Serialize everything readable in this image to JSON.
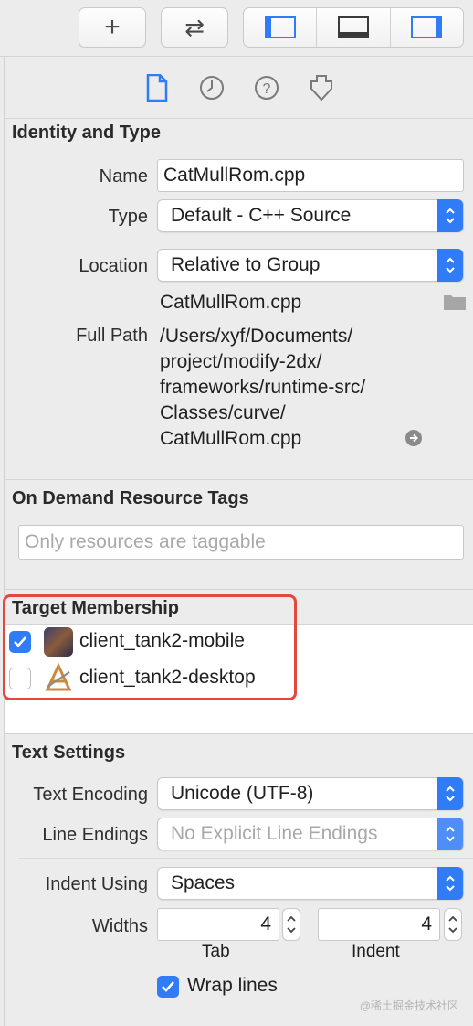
{
  "toolbar": {
    "add_glyph": "+",
    "swap_glyph": "⇄"
  },
  "tabs": [
    "file-inspector-icon",
    "history-icon",
    "help-icon",
    "attributes-icon"
  ],
  "identity": {
    "title": "Identity and Type",
    "name_label": "Name",
    "name_value": "CatMullRom.cpp",
    "type_label": "Type",
    "type_value": "Default - C++ Source",
    "location_label": "Location",
    "location_value": "Relative to Group",
    "file_name": "CatMullRom.cpp",
    "full_path_label": "Full Path",
    "full_path_lines": [
      "/Users/xyf/Documents/",
      "project/modify-2dx/",
      "frameworks/runtime-src/",
      "Classes/curve/",
      "CatMullRom.cpp"
    ]
  },
  "odr": {
    "title": "On Demand Resource Tags",
    "placeholder": "Only resources are taggable"
  },
  "membership": {
    "title": "Target Membership",
    "targets": [
      {
        "label": "client_tank2-mobile",
        "checked": true
      },
      {
        "label": "client_tank2-desktop",
        "checked": false
      }
    ]
  },
  "text_settings": {
    "title": "Text Settings",
    "encoding_label": "Text Encoding",
    "encoding_value": "Unicode (UTF-8)",
    "line_endings_label": "Line Endings",
    "line_endings_value": "No Explicit Line Endings",
    "indent_using_label": "Indent Using",
    "indent_using_value": "Spaces",
    "widths_label": "Widths",
    "tab_value": "4",
    "tab_caption": "Tab",
    "indent_value": "4",
    "indent_caption": "Indent",
    "wrap_label": "Wrap lines",
    "wrap_checked": true
  },
  "watermark": "@稀土掘金技术社区",
  "colors": {
    "accent": "#2f7cf6",
    "highlight": "#e2483b"
  }
}
